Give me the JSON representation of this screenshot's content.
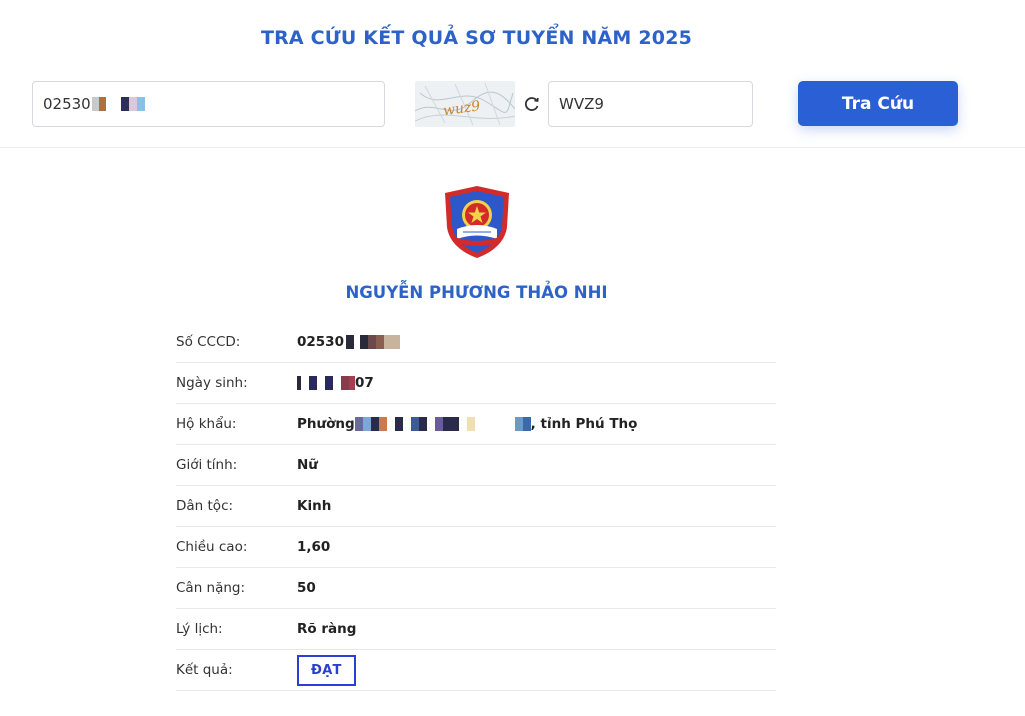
{
  "header": {
    "title": "TRA CỨU KẾT QUẢ SƠ TUYỂN NĂM 2025"
  },
  "search": {
    "cccd_value_visible": "02530",
    "captcha_text": "wuz9",
    "captcha_value": "WVZ9",
    "button_label": "Tra Cứu"
  },
  "profile": {
    "name": "NGUYỄN PHƯƠNG THẢO NHI"
  },
  "details": {
    "cccd": {
      "label": "Số CCCD:",
      "value": "02530"
    },
    "dob": {
      "label": "Ngày sinh:",
      "value_prefix": "",
      "value_suffix": "07"
    },
    "address": {
      "label": "Hộ khẩu:",
      "value_prefix": "Phường",
      "value_suffix": ", tỉnh Phú Thọ"
    },
    "gender": {
      "label": "Giới tính:",
      "value": "Nữ"
    },
    "ethnicity": {
      "label": "Dân tộc:",
      "value": "Kinh"
    },
    "height": {
      "label": "Chiều cao:",
      "value": "1,60"
    },
    "weight": {
      "label": "Cân nặng:",
      "value": "50"
    },
    "background": {
      "label": "Lý lịch:",
      "value": "Rõ ràng"
    },
    "result": {
      "label": "Kết quả:",
      "value": "ĐẠT"
    }
  },
  "colors": {
    "accent": "#2d63c8",
    "button": "#2a5fd6",
    "badge": "#2b3fd6"
  }
}
